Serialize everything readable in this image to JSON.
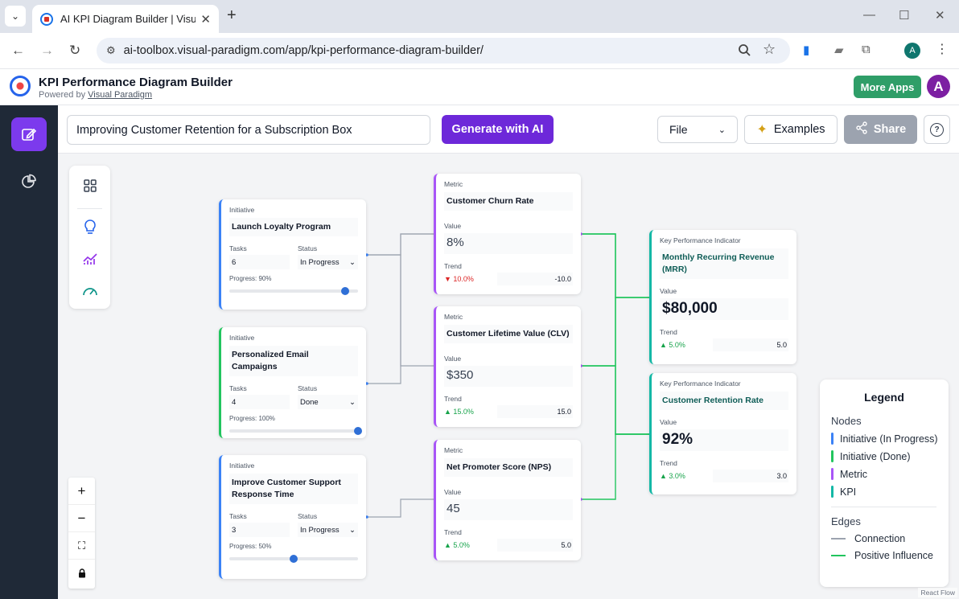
{
  "browser": {
    "tab_title": "AI KPI Diagram Builder | Visual Paradigm",
    "url": "ai-toolbox.visual-paradigm.com/app/kpi-performance-diagram-builder/",
    "profile_initial": "A"
  },
  "app": {
    "title": "KPI Performance Diagram Builder",
    "powered_prefix": "Powered by",
    "powered_link": "Visual Paradigm",
    "more_apps": "More Apps",
    "user_initial": "A"
  },
  "toolbar": {
    "prompt_value": "Improving Customer Retention for a Subscription Box",
    "generate_label": "Generate with AI",
    "file_label": "File",
    "examples_label": "Examples",
    "share_label": "Share"
  },
  "nodes": {
    "loyalty": {
      "type": "Initiative",
      "title": "Launch Loyalty Program",
      "tasks_label": "Tasks",
      "tasks": "6",
      "status_label": "Status",
      "status": "In Progress",
      "progress_label": "Progress: 90%",
      "progress": 0.9
    },
    "email": {
      "type": "Initiative",
      "title": "Personalized Email Campaigns",
      "tasks_label": "Tasks",
      "tasks": "4",
      "status_label": "Status",
      "status": "Done",
      "progress_label": "Progress: 100%",
      "progress": 1.0
    },
    "support": {
      "type": "Initiative",
      "title": "Improve Customer Support Response Time",
      "tasks_label": "Tasks",
      "tasks": "3",
      "status_label": "Status",
      "status": "In Progress",
      "progress_label": "Progress: 50%",
      "progress": 0.5
    },
    "churn": {
      "type": "Metric",
      "title": "Customer Churn Rate",
      "value_label": "Value",
      "value": "8%",
      "trend_label": "Trend",
      "trend": "▼ 10.0%",
      "trend_num": "-10.0"
    },
    "clv": {
      "type": "Metric",
      "title": "Customer Lifetime Value (CLV)",
      "value_label": "Value",
      "value": "$350",
      "trend_label": "Trend",
      "trend": "▲ 15.0%",
      "trend_num": "15.0"
    },
    "nps": {
      "type": "Metric",
      "title": "Net Promoter Score (NPS)",
      "value_label": "Value",
      "value": "45",
      "trend_label": "Trend",
      "trend": "▲ 5.0%",
      "trend_num": "5.0"
    },
    "mrr": {
      "type": "Key Performance Indicator",
      "title": "Monthly Recurring Revenue (MRR)",
      "value_label": "Value",
      "value": "$80,000",
      "trend_label": "Trend",
      "trend": "▲ 5.0%",
      "trend_num": "5.0"
    },
    "retention": {
      "type": "Key Performance Indicator",
      "title": "Customer Retention Rate",
      "value_label": "Value",
      "value": "92%",
      "trend_label": "Trend",
      "trend": "▲ 3.0%",
      "trend_num": "3.0"
    }
  },
  "legend": {
    "title": "Legend",
    "nodes_heading": "Nodes",
    "node_items": [
      "Initiative (In Progress)",
      "Initiative (Done)",
      "Metric",
      "KPI"
    ],
    "edges_heading": "Edges",
    "edge_items": [
      "Connection",
      "Positive Influence"
    ]
  },
  "colors": {
    "initiative_in_progress": "#3b82f6",
    "initiative_done": "#22c55e",
    "metric": "#a855f7",
    "kpi": "#14b8a6",
    "connection": "#9ca3af",
    "positive_influence": "#22c55e",
    "accent": "#6d28d9"
  },
  "attribution": "React Flow"
}
